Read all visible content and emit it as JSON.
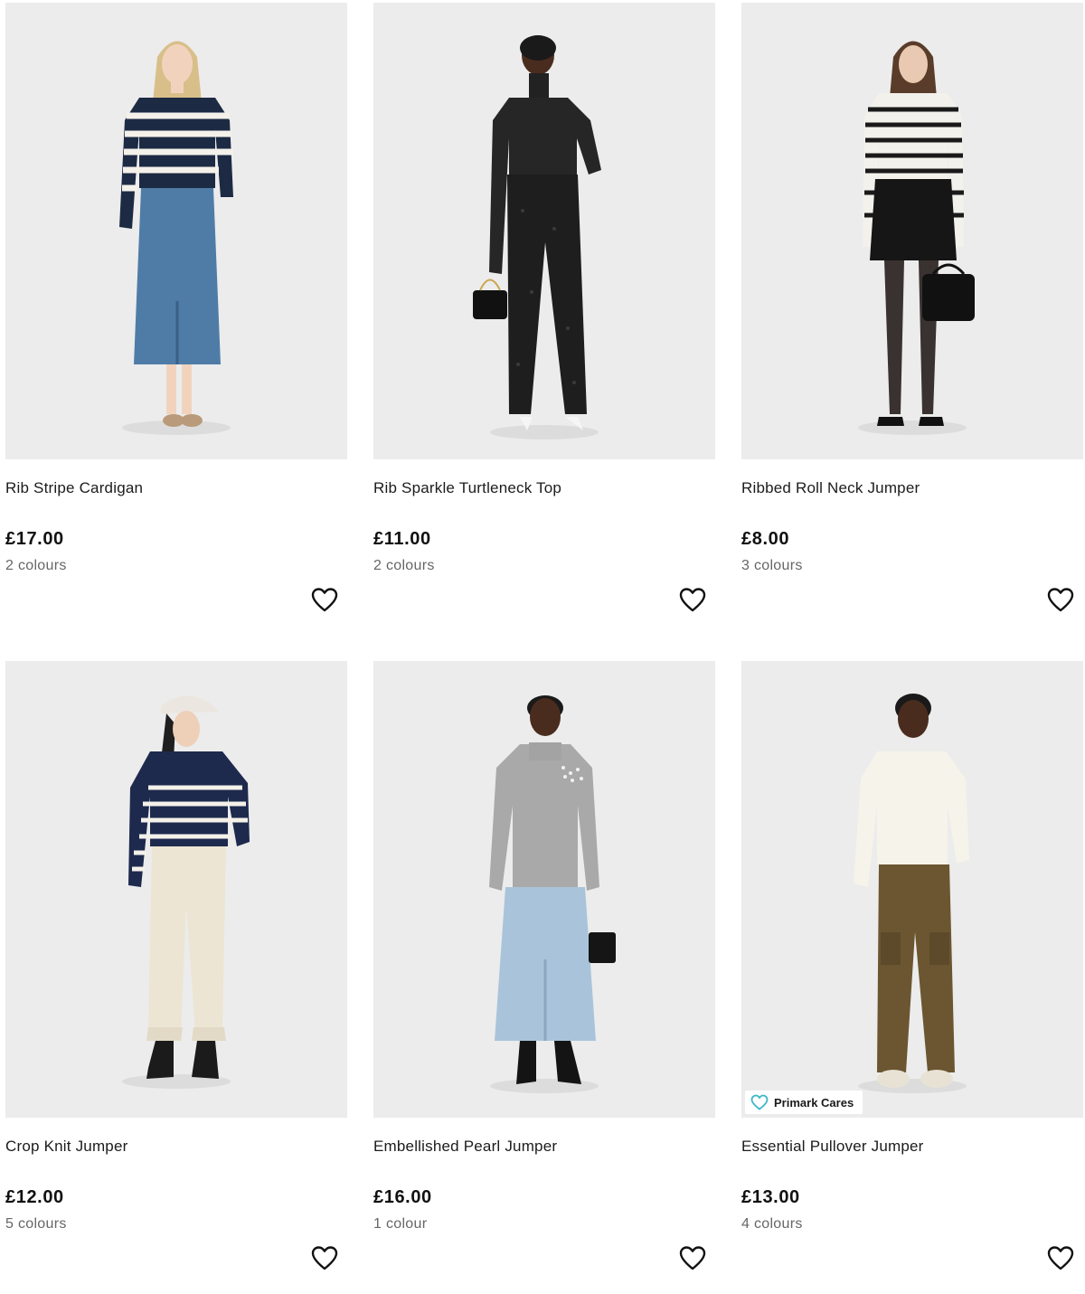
{
  "products": [
    {
      "name": "Rib Stripe Cardigan",
      "price": "£17.00",
      "colours": "2 colours"
    },
    {
      "name": "Rib Sparkle Turtleneck Top",
      "price": "£11.00",
      "colours": "2 colours"
    },
    {
      "name": "Ribbed Roll Neck Jumper",
      "price": "£8.00",
      "colours": "3 colours"
    },
    {
      "name": "Crop Knit Jumper",
      "price": "£12.00",
      "colours": "5 colours"
    },
    {
      "name": "Embellished Pearl Jumper",
      "price": "£16.00",
      "colours": "1 colour"
    },
    {
      "name": "Essential Pullover Jumper",
      "price": "£13.00",
      "colours": "4 colours",
      "badge": "Primark Cares"
    }
  ],
  "icons": {
    "wishlist": "heart-outline-icon",
    "badge": "heart-icon"
  },
  "colors": {
    "photo_bg": "#ececec",
    "badge_heart": "#3fb6c9",
    "price": "#111111",
    "meta": "#666666"
  }
}
